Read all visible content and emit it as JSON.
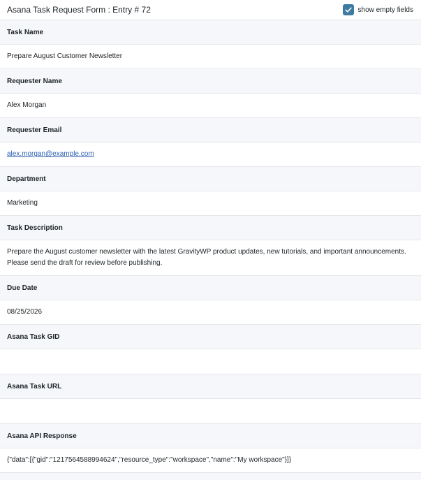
{
  "header": {
    "title": "Asana Task Request Form : Entry # 72",
    "toggle_label": "show empty fields",
    "toggle_checked": true,
    "accent_color": "#3e7ba2"
  },
  "fields": [
    {
      "label": "Task Name",
      "value": "Prepare August Customer Newsletter"
    },
    {
      "label": "Requester Name",
      "value": "Alex Morgan"
    },
    {
      "label": "Requester Email",
      "value": "alex.morgan@example.com"
    },
    {
      "label": "Department",
      "value": "Marketing"
    },
    {
      "label": "Task Description",
      "value": "Prepare the August customer newsletter with the latest GravityWP product updates, new tutorials, and important announcements. Please send the draft for review before publishing."
    },
    {
      "label": "Due Date",
      "value": "08/25/2026"
    },
    {
      "label": "Asana Task GID",
      "value": ""
    },
    {
      "label": "Asana Task URL",
      "value": ""
    },
    {
      "label": "Asana API Response",
      "value": "{\"data\":[{\"gid\":\"1217564588994624\",\"resource_type\":\"workspace\",\"name\":\"My workspace\"}]}"
    }
  ]
}
